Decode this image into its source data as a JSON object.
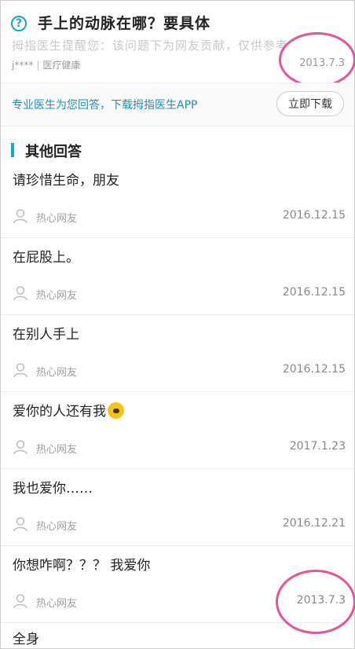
{
  "question": {
    "icon": "question-circle-icon",
    "title": "手上的动脉在哪？要具体",
    "notice": "拇指医生提醒您：该问题下为网友贡献，仅供参考",
    "user": "j****",
    "category": "医疗健康",
    "date": "2013.7.3"
  },
  "promo": {
    "text": "专业医生为您回答，下载拇指医生APP",
    "button": "立即下载"
  },
  "section": {
    "title": "其他回答"
  },
  "answers": [
    {
      "text": "请珍惜生命，朋友",
      "user": "热心网友",
      "date": "2016.12.15"
    },
    {
      "text": "在屁股上。",
      "user": "热心网友",
      "date": "2016.12.15"
    },
    {
      "text": "在别人手上",
      "user": "热心网友",
      "date": "2016.12.15"
    },
    {
      "text": "爱你的人还有我",
      "user": "热心网友",
      "date": "2017.1.23",
      "emoji": "yellow-emoji-icon"
    },
    {
      "text": "我也爱你……",
      "user": "热心网友",
      "date": "2016.12.21"
    },
    {
      "text": "你想咋啊？？？ 我爱你",
      "user": "热心网友",
      "date": "2013.7.3"
    }
  ],
  "last_answer": {
    "text": "全身"
  },
  "colors": {
    "accent": "#17a8c4",
    "link": "#1d8fbd",
    "annotation": "#e3408f"
  }
}
